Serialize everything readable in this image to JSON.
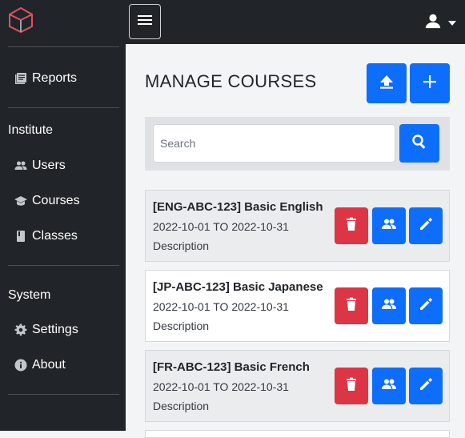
{
  "header": {
    "menu_icon": "hamburger-icon",
    "user_icon": "user-icon",
    "caret_icon": "caret-down-icon",
    "logo_icon": "cube-icon"
  },
  "sidebar": {
    "reports_label": "Reports",
    "institute_title": "Institute",
    "users_label": "Users",
    "courses_label": "Courses",
    "classes_label": "Classes",
    "system_title": "System",
    "settings_label": "Settings",
    "about_label": "About"
  },
  "main": {
    "title": "MANAGE COURSES",
    "upload_icon": "upload-icon",
    "add_icon": "plus-icon"
  },
  "search": {
    "placeholder": "Search",
    "value": ""
  },
  "courses": [
    {
      "title": "[ENG-ABC-123] Basic English",
      "dates": "2022-10-01 TO 2022-10-31",
      "description": "Description"
    },
    {
      "title": "[JP-ABC-123] Basic Japanese",
      "dates": "2022-10-01 TO 2022-10-31",
      "description": "Description"
    },
    {
      "title": "[FR-ABC-123] Basic French",
      "dates": "2022-10-01 TO 2022-10-31",
      "description": "Description"
    }
  ],
  "colors": {
    "primary": "#0d6efd",
    "danger": "#dc3545",
    "dark": "#212529"
  }
}
